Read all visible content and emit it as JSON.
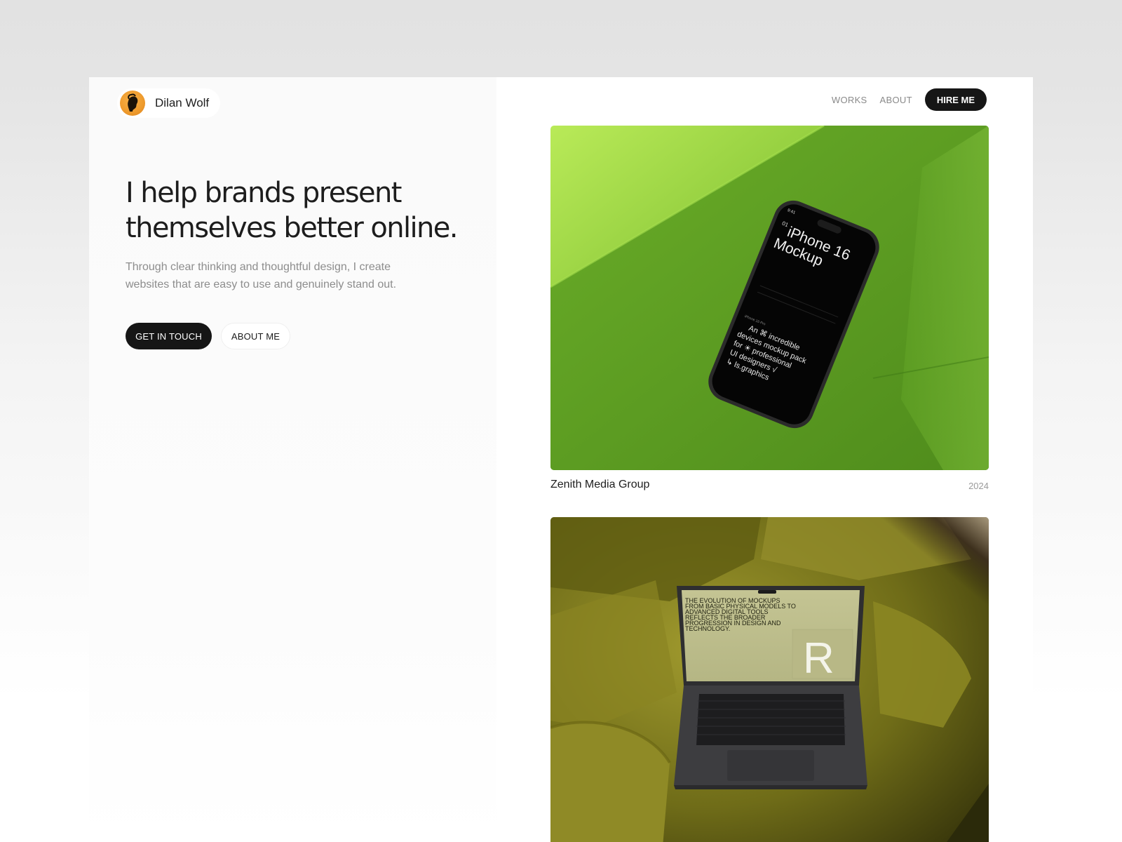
{
  "brand": {
    "name": "Dilan Wolf"
  },
  "nav": {
    "works": "WORKS",
    "about": "ABOUT",
    "hire": "HIRE ME"
  },
  "hero": {
    "headline": "I help brands present themselves better online.",
    "subtext": "Through clear thinking and thoughtful design, I create websites that are easy to use and genuinely stand out.",
    "primary_cta": "GET IN TOUCH",
    "secondary_cta": "ABOUT ME"
  },
  "works": [
    {
      "title": "Zenith Media Group",
      "year": "2024",
      "mockup": {
        "time": "9:41",
        "index": "01",
        "title_line1": "iPhone 16",
        "title_line2": "Mockup",
        "caption_small": "iPhone 16 Pro",
        "lines": [
          "An ⌘ incredible",
          "devices mockup pack",
          "for ☀ professional",
          "UI designers √",
          "↳ ls.graphics"
        ]
      }
    },
    {
      "screen_text": [
        "THE EVOLUTION OF MOCKUPS",
        "FROM BASIC PHYSICAL MODELS TO",
        "ADVANCED DIGITAL TOOLS",
        "REFLECTS THE BROADER",
        "PROGRESSION IN DESIGN AND",
        "TECHNOLOGY."
      ],
      "screen_letter": "R"
    }
  ],
  "colors": {
    "accent": "#161616",
    "green": "#6fb52a",
    "olive": "#7f7d1c"
  }
}
